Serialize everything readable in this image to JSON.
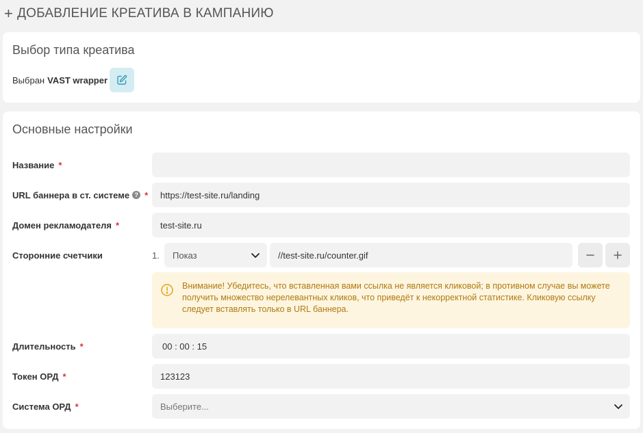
{
  "header": {
    "plus": "+",
    "title": "ДОБАВЛЕНИЕ КРЕАТИВА В КАМПАНИЮ"
  },
  "type_section": {
    "title": "Выбор типа креатива",
    "selected_prefix": "Выбран",
    "selected_value": "VAST wrapper"
  },
  "main_section": {
    "title": "Основные настройки",
    "required_mark": "*",
    "help_mark": "?",
    "fields": {
      "name": {
        "label": "Название",
        "value": ""
      },
      "banner_url": {
        "label": "URL баннера в ст. системе",
        "value": "https://test-site.ru/landing"
      },
      "advertiser_domain": {
        "label": "Домен рекламодателя",
        "value": "test-site.ru"
      },
      "counters": {
        "label": "Сторонние счетчики",
        "items": [
          {
            "num": "1.",
            "type": "Показ",
            "url": "//test-site.ru/counter.gif"
          }
        ]
      },
      "warning": "Внимание! Убедитесь, что вставленная вами ссылка не является кликовой; в противном случае вы можете получить множество нерелевантных кликов, что приведёт к некорректной статистике. Кликовую ссылку следует вставлять только в URL баннера.",
      "duration": {
        "label": "Длительность",
        "value": "00 : 00 : 15"
      },
      "ord_token": {
        "label": "Токен ОРД",
        "value": "123123"
      },
      "ord_system": {
        "label": "Система ОРД",
        "placeholder": "Выберите..."
      }
    }
  },
  "colors": {
    "background": "#f2f2f2",
    "card": "#ffffff",
    "required": "#d9323c",
    "edit_button_bg": "#d4edf3",
    "edit_icon": "#3a9bb5",
    "warning_bg": "#fdf5e0",
    "warning_text": "#b07a10"
  }
}
